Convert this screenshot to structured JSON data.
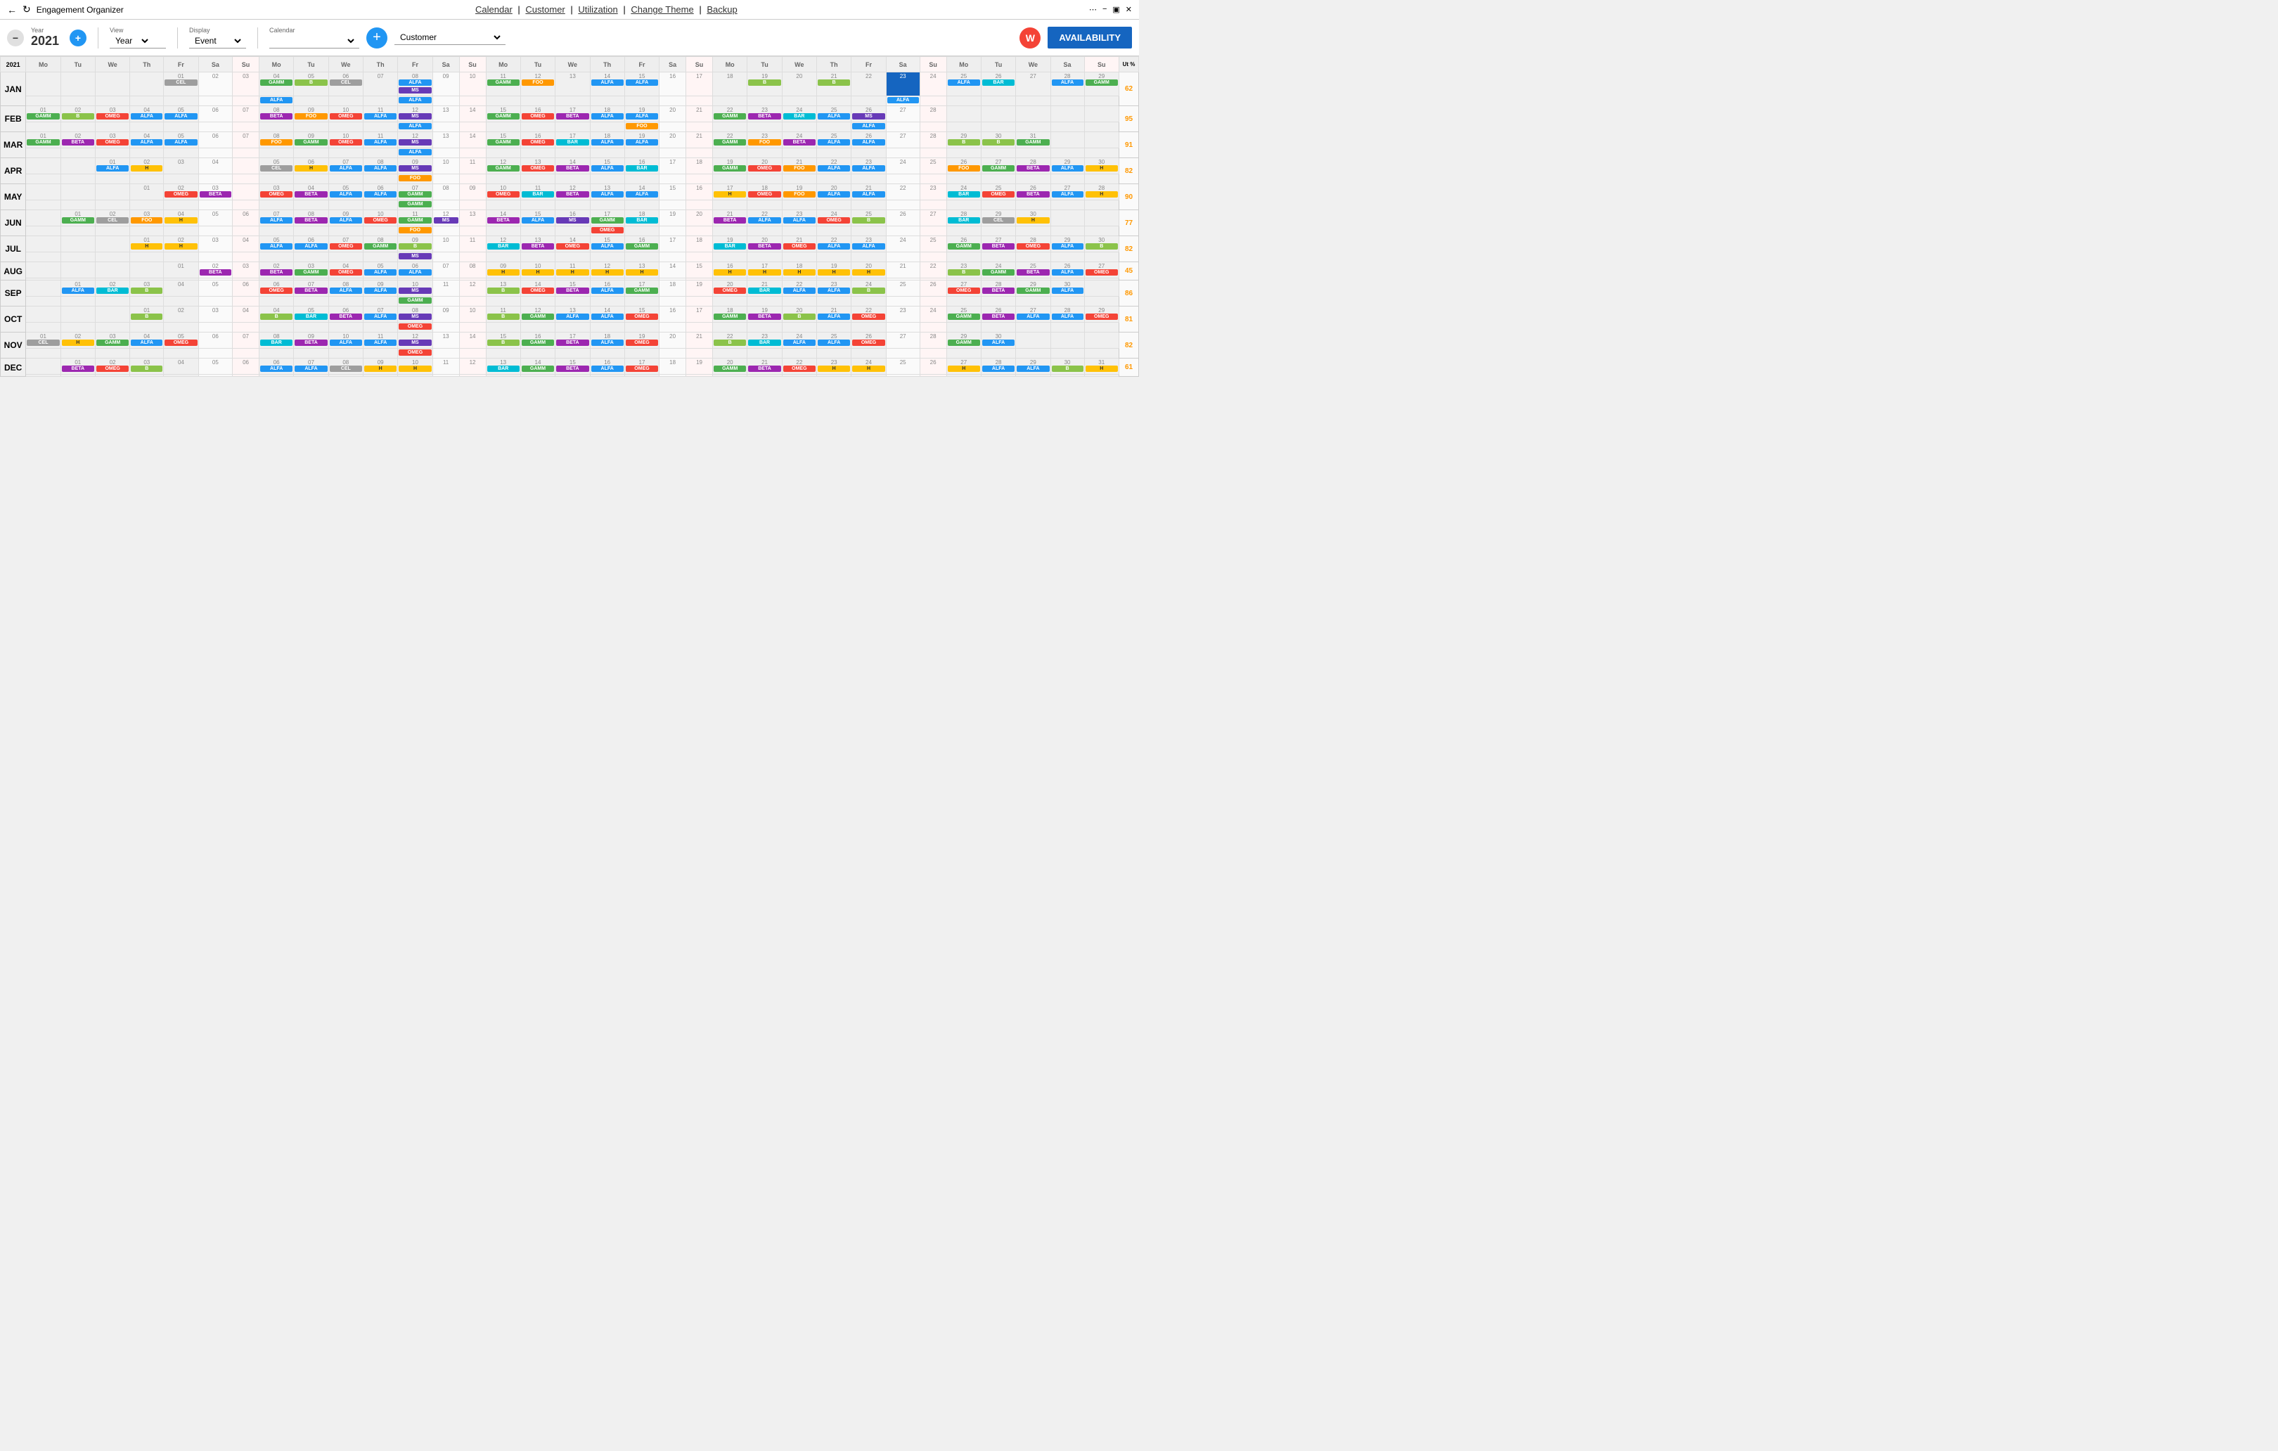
{
  "app": {
    "title": "Engagement Organizer"
  },
  "nav": {
    "calendar": "Calendar",
    "customer": "Customer",
    "utilization": "Utilization",
    "change_theme": "Change Theme",
    "backup": "Backup"
  },
  "toolbar": {
    "year_label": "Year",
    "year_value": "2021",
    "view_label": "View",
    "view_value": "Year",
    "display_label": "Display",
    "display_value": "Event",
    "calendar_label": "Calendar",
    "customer_label": "Customer",
    "customer_value": "Customer",
    "availability_btn": "AVAILABILITY"
  },
  "user": {
    "initial": "W"
  },
  "months": [
    {
      "name": "JAN",
      "ut": 62
    },
    {
      "name": "FEB",
      "ut": 95
    },
    {
      "name": "MAR",
      "ut": 91
    },
    {
      "name": "APR",
      "ut": 82
    },
    {
      "name": "MAY",
      "ut": 90
    },
    {
      "name": "JUN",
      "ut": 77
    },
    {
      "name": "JUL",
      "ut": 82
    },
    {
      "name": "AUG",
      "ut": 45
    },
    {
      "name": "SEP",
      "ut": 86
    },
    {
      "name": "OCT",
      "ut": 81
    },
    {
      "name": "NOV",
      "ut": 82
    },
    {
      "name": "DEC",
      "ut": 61
    }
  ]
}
